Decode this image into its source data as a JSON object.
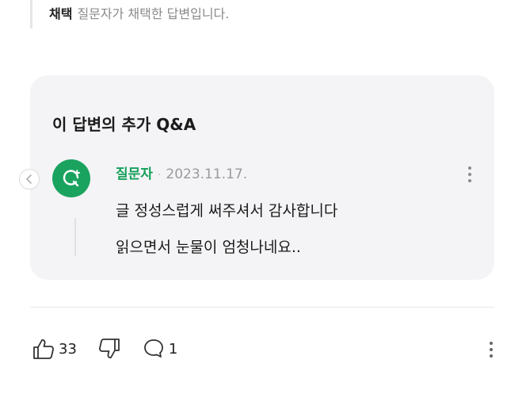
{
  "adoption": {
    "tag": "채택",
    "text": "질문자가 채택한 답변입니다."
  },
  "qa": {
    "title": "이 답변의 추가 Q&A",
    "author": "질문자",
    "separator": "·",
    "date": "2023.11.17.",
    "lines": [
      "글 정성스럽게 써주셔서 감사합니다",
      "읽으면서 눈물이 엄청나네요.."
    ]
  },
  "actions": {
    "likes": "33",
    "comments": "1"
  },
  "icons": {
    "avatar": "question-add-icon",
    "prev": "chevron-left-icon",
    "more": "more-vertical-icon",
    "like": "thumbs-up-icon",
    "dislike": "thumbs-down-icon",
    "comment": "comment-icon"
  },
  "colors": {
    "accent_green": "#1aa35f",
    "card_bg": "#f4f4f6"
  }
}
